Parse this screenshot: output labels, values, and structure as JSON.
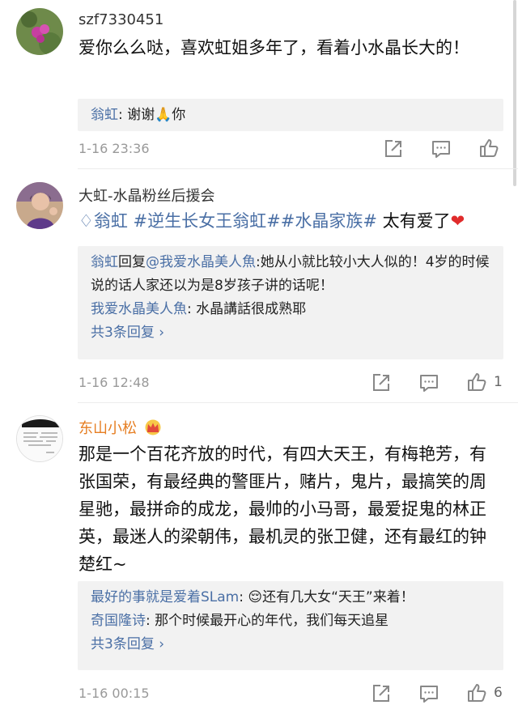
{
  "comments": [
    {
      "username": "szf7330451",
      "text": "爱你么么哒，喜欢虹姐多年了，看着小水晶长大的！",
      "replies": [
        {
          "author": "翁虹",
          "content": ": 谢谢🙏你"
        }
      ],
      "time": "1-16 23:36",
      "likes": ""
    },
    {
      "username": "大虹-水晶粉丝后援会",
      "text_parts": {
        "diamond": "翁虹",
        "topic1": "#逆生长女王翁虹#",
        "topic2": "#水晶家族#",
        "rest": "太有爱了"
      },
      "replies": [
        {
          "author": "翁虹",
          "verb": "回复",
          "mention": "@我爱水晶美人魚",
          "content": ":她从小就比较小大人似的！4岁的时候说的话人家还以为是8岁孩子讲的话呢！"
        },
        {
          "author": "我爱水晶美人魚",
          "content": ": 水晶講話很成熟耶"
        }
      ],
      "more_replies": "共3条回复 ›",
      "time": "1-16 12:48",
      "likes": "1"
    },
    {
      "username": "东山小松",
      "text": "那是一个百花齐放的时代，有四大天王，有梅艳芳，有张国荣，有最经典的警匪片，赌片，鬼片，最搞笑的周星驰，最拼命的成龙，最帅的小马哥，最爱捉鬼的林正英，最迷人的梁朝伟，最机灵的张卫健，还有最红的钟楚红~",
      "replies": [
        {
          "author": "最好的事就是爱着SLam",
          "content": ": 😌还有几大女“天王”来着！"
        },
        {
          "author": "奇国隆诗",
          "content": ": 那个时候最开心的年代，我们每天追星"
        }
      ],
      "more_replies": "共3条回复 ›",
      "time": "1-16 00:15",
      "likes": "6"
    }
  ],
  "icons": {
    "share": "share-icon",
    "comment": "comment-icon",
    "like": "like-icon",
    "crown": "crown-icon"
  },
  "colors": {
    "link": "#4a6fa5",
    "meta": "#999999",
    "reply_bg": "#f2f2f2"
  }
}
